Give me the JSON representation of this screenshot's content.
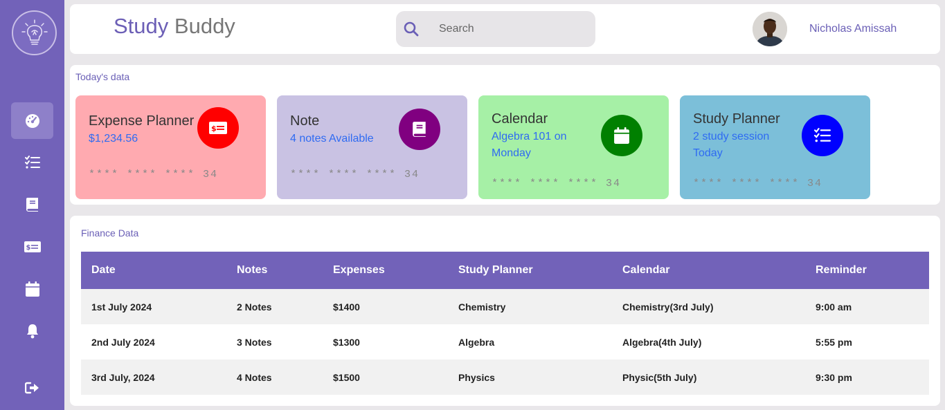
{
  "app": {
    "title_part1": "Study",
    "title_part2": "Buddy"
  },
  "search": {
    "placeholder": "Search"
  },
  "user": {
    "name": "Nicholas Amissah"
  },
  "sidebar": {
    "items": [
      {
        "name": "dashboard",
        "icon": "gauge-icon"
      },
      {
        "name": "tasks",
        "icon": "checklist-icon"
      },
      {
        "name": "notes",
        "icon": "book-icon"
      },
      {
        "name": "expenses",
        "icon": "money-bill-icon"
      },
      {
        "name": "calendar",
        "icon": "calendar-icon"
      },
      {
        "name": "reminders",
        "icon": "bell-icon"
      },
      {
        "name": "logout",
        "icon": "logout-icon"
      }
    ]
  },
  "today": {
    "label": "Today's data",
    "cards": [
      {
        "title": "Expense Planner",
        "subtitle": "$1,234.56",
        "mask": "**** **** **** 34",
        "color": "#ffaab0",
        "icon_color": "#ff0000",
        "icon": "money-bill-icon"
      },
      {
        "title": "Note",
        "subtitle": "4 notes Available",
        "mask": "**** **** **** 34",
        "color": "#c9c2e3",
        "icon_color": "#800080",
        "icon": "book-icon"
      },
      {
        "title": "Calendar",
        "subtitle": "Algebra 101 on Monday",
        "mask": "**** **** **** 34",
        "color": "#a6f0a6",
        "icon_color": "#008000",
        "icon": "calendar-icon"
      },
      {
        "title": "Study Planner",
        "subtitle": "2 study session Today",
        "mask": "**** **** **** 34",
        "color": "#7cbfd9",
        "icon_color": "#0000ff",
        "icon": "checklist-icon"
      }
    ]
  },
  "finance": {
    "label": "Finance Data",
    "columns": [
      "Date",
      "Notes",
      "Expenses",
      "Study Planner",
      "Calendar",
      "Reminder"
    ],
    "rows": [
      [
        "1st July 2024",
        "2 Notes",
        "$1400",
        "Chemistry",
        "Chemistry(3rd July)",
        "9:00 am"
      ],
      [
        "2nd July 2024",
        "3 Notes",
        "$1300",
        "Algebra",
        "Algebra(4th July)",
        "5:55 pm"
      ],
      [
        "3rd July, 2024",
        "4 Notes",
        "$1500",
        "Physics",
        "Physic(5th July)",
        "9:30 pm"
      ]
    ]
  }
}
